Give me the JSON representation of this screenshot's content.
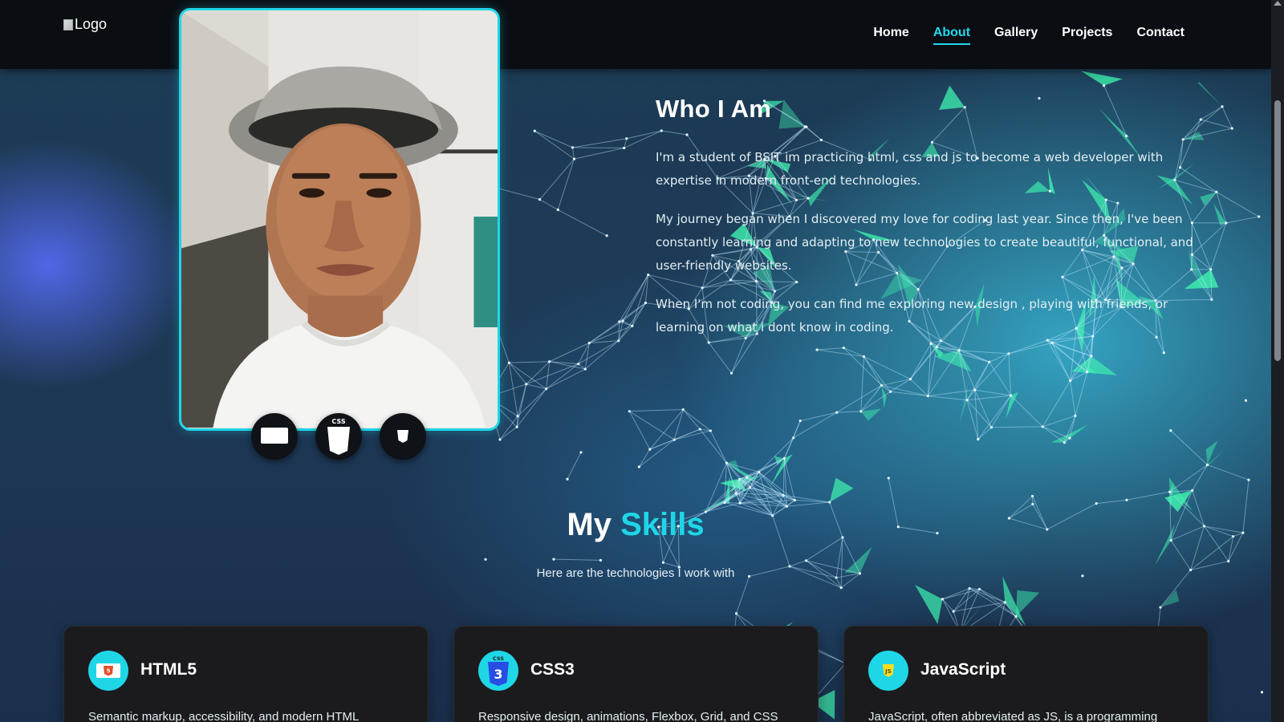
{
  "nav": {
    "logo_alt": "Logo",
    "links": [
      {
        "label": "Home",
        "active": false
      },
      {
        "label": "About",
        "active": true
      },
      {
        "label": "Gallery",
        "active": false
      },
      {
        "label": "Projects",
        "active": false
      },
      {
        "label": "Contact",
        "active": false
      }
    ]
  },
  "about": {
    "title": "Who I Am",
    "paragraphs": [
      "I'm a student of BSIT im practicing html, css and js to become a web developer with expertise in modern front-end technologies.",
      "My journey began when I discovered my love for coding last year. Since then, I've been constantly learning and adapting to new technologies to create beautiful, functional, and user-friendly websites.",
      "When I'm not coding, you can find me exploring new design , playing with friends, or learning on what i dont know in coding."
    ]
  },
  "social": [
    {
      "icon": "html-icon"
    },
    {
      "icon": "css-icon"
    },
    {
      "icon": "js-icon"
    }
  ],
  "skills": {
    "title_main": "My",
    "title_accent": "Skills",
    "subtitle": "Here are the technologies I work with",
    "cards": [
      {
        "name": "HTML5",
        "icon": "html5-icon",
        "desc": "Semantic markup, accessibility, and modern HTML"
      },
      {
        "name": "CSS3",
        "icon": "css3-icon",
        "desc": "Responsive design, animations, Flexbox, Grid, and CSS"
      },
      {
        "name": "JavaScript",
        "icon": "javascript-icon",
        "desc": "JavaScript, often abbreviated as JS, is a programming"
      }
    ]
  },
  "colors": {
    "accent": "#1fd6e6",
    "nav_bg": "#0a0d12",
    "card_bg": "#1b1b1d",
    "network": "#3ff2b0"
  }
}
